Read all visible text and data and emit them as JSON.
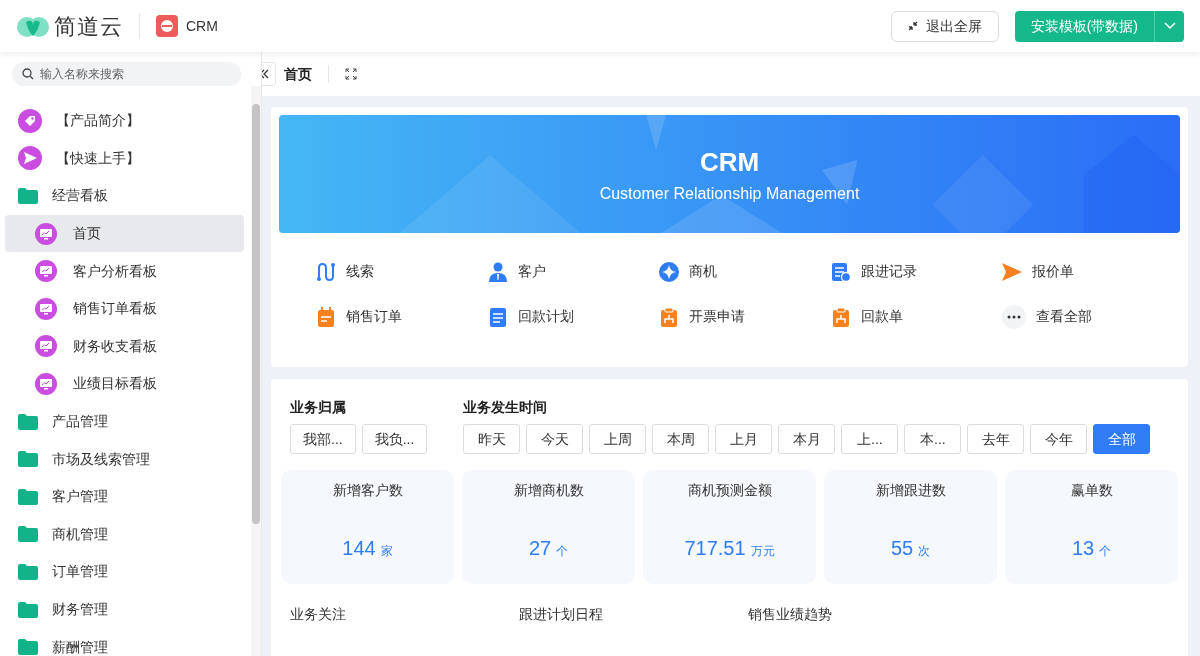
{
  "header": {
    "brand": "简道云",
    "app": "CRM",
    "exit_button": "退出全屏",
    "install_button": "安装模板(带数据)"
  },
  "sidebar": {
    "search": {
      "placeholder": "输入名称来搜索"
    },
    "items": [
      {
        "kind": "tag",
        "label": "【产品简介】",
        "selected": false
      },
      {
        "kind": "send",
        "label": "【快速上手】",
        "selected": false
      },
      {
        "kind": "folder",
        "label": "经营看板",
        "selected": false,
        "children": [
          {
            "kind": "dashboard",
            "label": "首页",
            "selected": true
          },
          {
            "kind": "dashboard",
            "label": "客户分析看板",
            "selected": false
          },
          {
            "kind": "dashboard",
            "label": "销售订单看板",
            "selected": false
          },
          {
            "kind": "dashboard",
            "label": "财务收支看板",
            "selected": false
          },
          {
            "kind": "dashboard",
            "label": "业绩目标看板",
            "selected": false
          }
        ]
      },
      {
        "kind": "folder",
        "label": "产品管理",
        "selected": false
      },
      {
        "kind": "folder",
        "label": "市场及线索管理",
        "selected": false
      },
      {
        "kind": "folder",
        "label": "客户管理",
        "selected": false
      },
      {
        "kind": "folder",
        "label": "商机管理",
        "selected": false
      },
      {
        "kind": "folder",
        "label": "订单管理",
        "selected": false
      },
      {
        "kind": "folder",
        "label": "财务管理",
        "selected": false
      },
      {
        "kind": "folder",
        "label": "薪酬管理",
        "selected": false
      }
    ]
  },
  "tab": {
    "label": "首页"
  },
  "banner": {
    "title": "CRM",
    "subtitle": "Customer Relationship Management"
  },
  "shortcuts": [
    {
      "kind": "route",
      "label": "线索",
      "color": "#2f7cf6"
    },
    {
      "kind": "person",
      "label": "客户",
      "color": "#2f7cf6"
    },
    {
      "kind": "star",
      "label": "商机",
      "color": "#2f7cf6"
    },
    {
      "kind": "record",
      "label": "跟进记录",
      "color": "#2f7cf6"
    },
    {
      "kind": "send",
      "label": "报价单",
      "color": "#f5821f"
    },
    {
      "kind": "calendar",
      "label": "销售订单",
      "color": "#f5821f"
    },
    {
      "kind": "doc",
      "label": "回款计划",
      "color": "#2f7cf6"
    },
    {
      "kind": "clipboard",
      "label": "开票申请",
      "color": "#f5821f"
    },
    {
      "kind": "clipboard",
      "label": "回款单",
      "color": "#f5821f"
    },
    {
      "kind": "more",
      "label": "查看全部",
      "color": "#f2f3f5"
    }
  ],
  "filters": [
    {
      "label": "业务归属",
      "options": [
        {
          "label": "我部...",
          "selected": false
        },
        {
          "label": "我负...",
          "selected": false
        }
      ]
    },
    {
      "label": "业务发生时间",
      "options": [
        {
          "label": "昨天",
          "selected": false
        },
        {
          "label": "今天",
          "selected": false
        },
        {
          "label": "上周",
          "selected": false
        },
        {
          "label": "本周",
          "selected": false
        },
        {
          "label": "上月",
          "selected": false
        },
        {
          "label": "本月",
          "selected": false
        },
        {
          "label": "上...",
          "selected": false
        },
        {
          "label": "本...",
          "selected": false
        },
        {
          "label": "去年",
          "selected": false
        },
        {
          "label": "今年",
          "selected": false
        },
        {
          "label": "全部",
          "selected": true
        }
      ]
    }
  ],
  "stats": [
    {
      "title": "新增客户数",
      "value": "144",
      "unit": "家"
    },
    {
      "title": "新增商机数",
      "value": "27",
      "unit": "个"
    },
    {
      "title": "商机预测金额",
      "value": "717.51",
      "unit": "万元"
    },
    {
      "title": "新增跟进数",
      "value": "55",
      "unit": "次"
    },
    {
      "title": "赢单数",
      "value": "13",
      "unit": "个"
    }
  ],
  "sections": [
    "业务关注",
    "跟进计划日程",
    "销售业绩趋势"
  ]
}
